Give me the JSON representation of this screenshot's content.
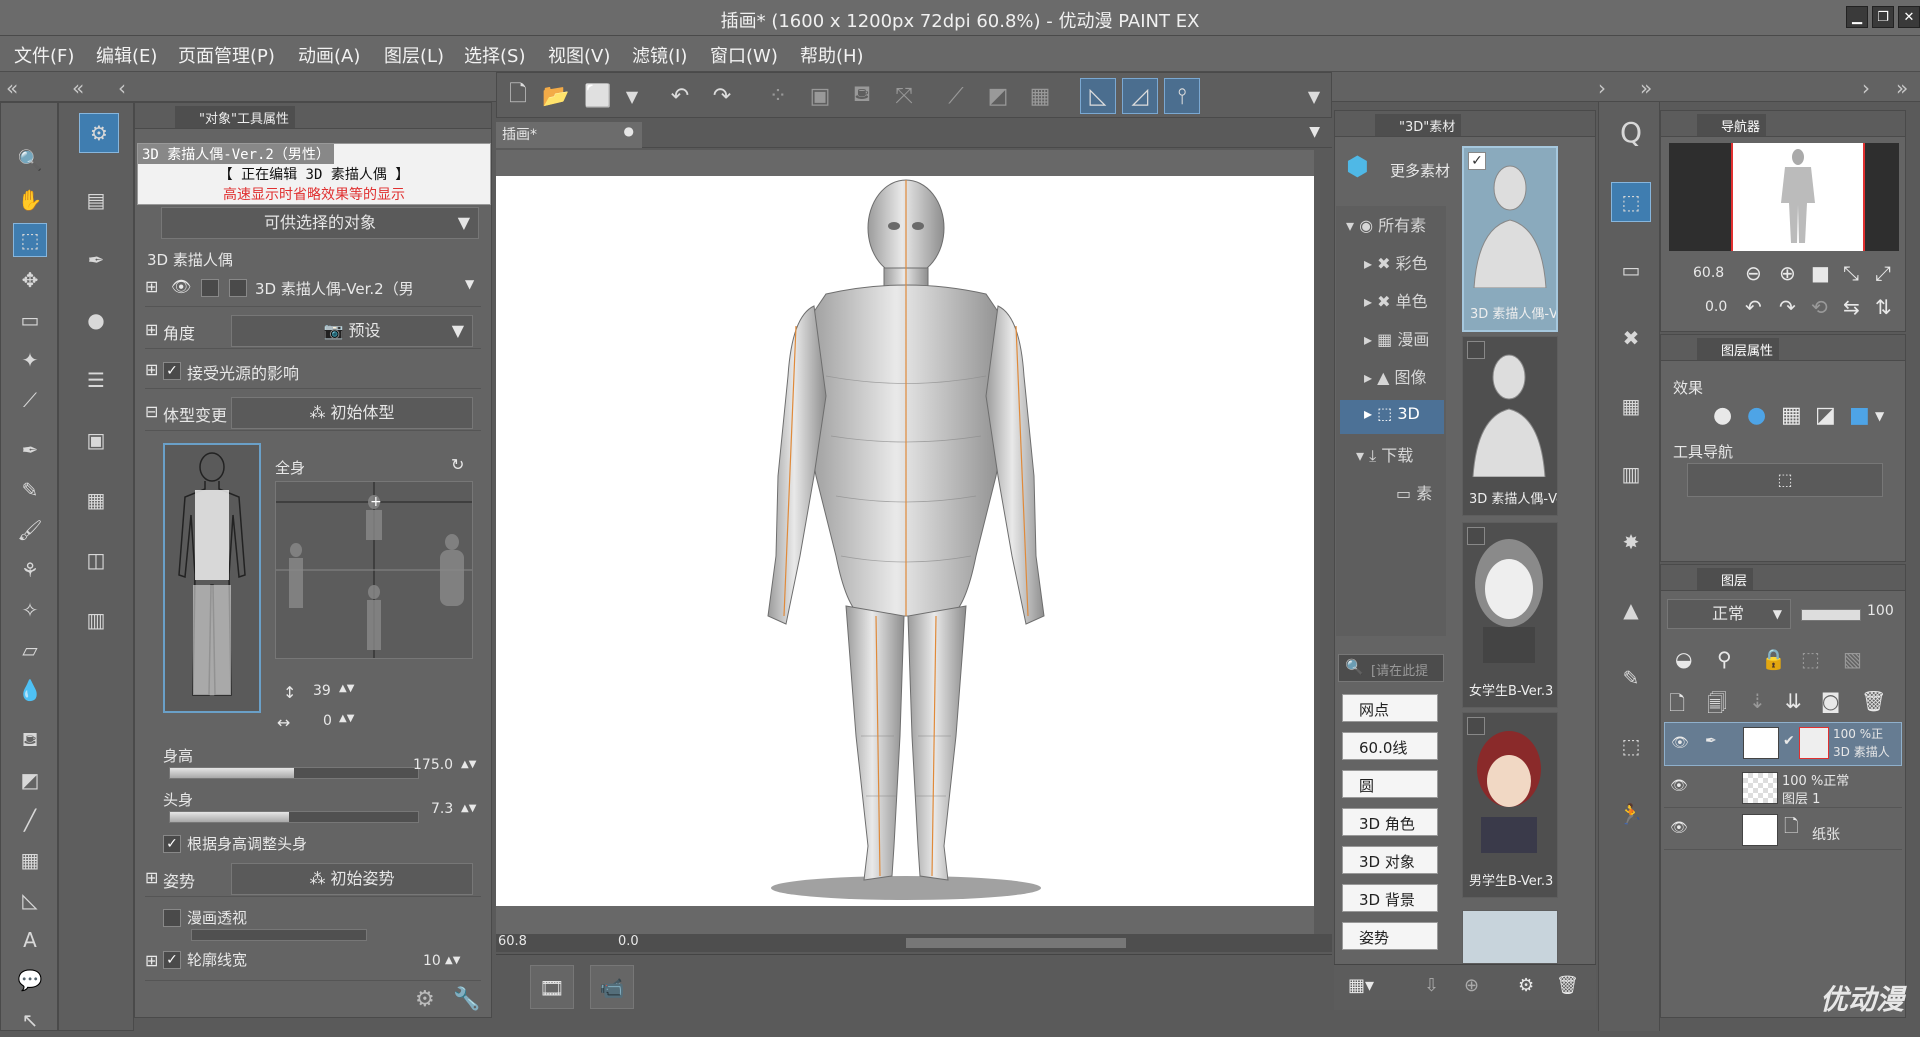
{
  "app_title": "插画* (1600 x 1200px 72dpi 60.8%)  - 优动漫 PAINT EX",
  "window_buttons": {
    "minimize": "▁",
    "restore": "❐",
    "close": "✕"
  },
  "menu": [
    "文件(F)",
    "编辑(E)",
    "页面管理(P)",
    "动画(A)",
    "图层(L)",
    "选择(S)",
    "视图(V)",
    "滤镜(I)",
    "窗口(W)",
    "帮助(H)"
  ],
  "tool_property": {
    "tab_label": "\"对象\"工具属性",
    "header_line1": "3D 素描人偶-Ver.2（男性）",
    "header_line2": "【 正在编辑 3D 素描人偶 】",
    "header_line3": "高速显示时省略效果等的显示",
    "selectable_object": "可供选择的对象",
    "section_3d_doll": "3D 素描人偶",
    "doll_item": "3D 素描人偶-Ver.2（男",
    "angle_label": "角度",
    "preset_label": "预设",
    "light_label": "接受光源的影响",
    "body_change_label": "体型变更",
    "initial_body_label": "初始体型",
    "whole_body_label": "全身",
    "vertical_value": "39",
    "horizontal_value": "0",
    "height_label": "身高",
    "height_value": "175.0",
    "height_fill": 0.5,
    "head_label": "头身",
    "head_value": "7.3",
    "head_fill": 0.48,
    "adjust_head_label": "根据身高调整头身",
    "pose_label": "姿势",
    "initial_pose_label": "初始姿势",
    "manga_perspective_label": "漫画透视",
    "outline_width_label": "轮廓线宽",
    "outline_width_value": "10"
  },
  "canvas": {
    "tab_label": "插画*",
    "zoom_value": "60.8",
    "rotation_value": "0.0"
  },
  "material_panel": {
    "tab_label": "\"3D\"素材",
    "more_materials": "更多素材",
    "categories": [
      "所有素",
      "彩色",
      "单色",
      "漫画",
      "图像",
      "3D",
      "下载",
      "素"
    ],
    "search_placeholder": "[请在此提",
    "tag_buttons": [
      "网点",
      "60.0线",
      "圆",
      "3D 角色",
      "3D 对象",
      "3D 背景",
      "姿势"
    ],
    "thumbnails": [
      "3D 素描人偶-Ver",
      "3D 素描人偶-Ver",
      "女学生B-Ver.3",
      "男学生B-Ver.3"
    ]
  },
  "navigator": {
    "tab_label": "导航器",
    "zoom_value": "60.8",
    "rotation_value": "0.0"
  },
  "layer_property": {
    "tab_label": "图层属性",
    "effect_label": "效果",
    "tool_nav_label": "工具导航"
  },
  "layers": {
    "tab_label": "图层",
    "blend_mode": "正常",
    "opacity": "100",
    "items": [
      {
        "line1": "100 %正",
        "line2": "3D 素描人"
      },
      {
        "line1": "100 %正常",
        "line2": "图层 1"
      },
      {
        "line1": "",
        "line2": "纸张"
      }
    ]
  },
  "watermark": "优动漫",
  "colors": {
    "accent": "#3f7db0",
    "panel": "#646464",
    "canvas_bg": "#ffffff",
    "warning_text": "#e03030"
  }
}
